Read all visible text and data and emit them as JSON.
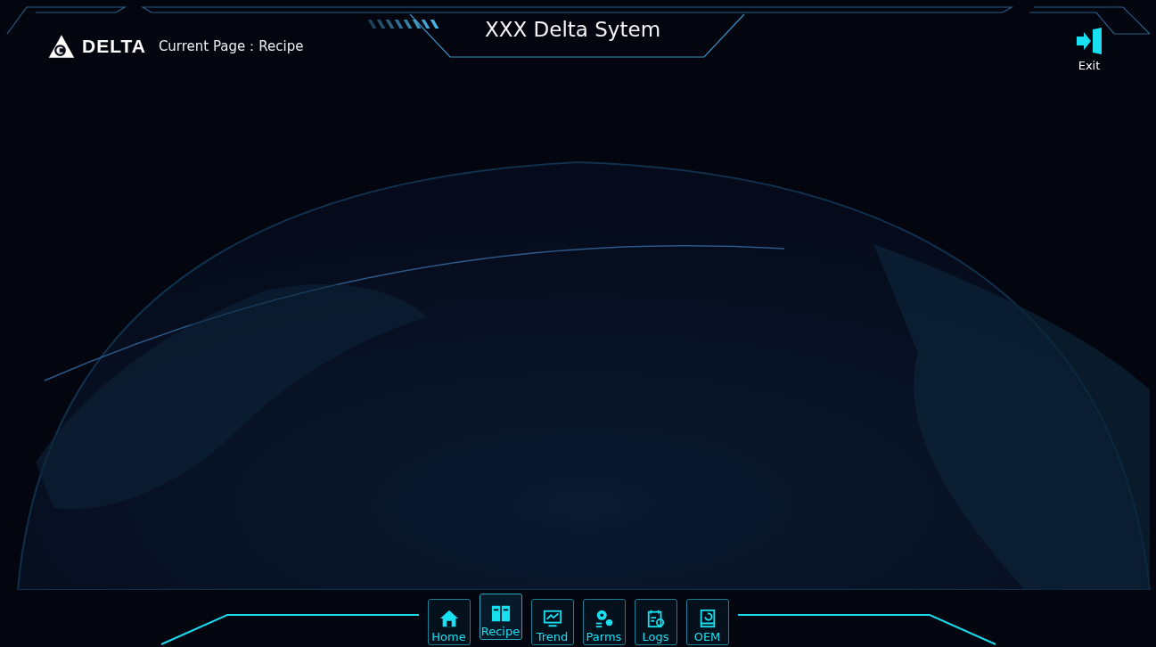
{
  "header": {
    "logo_text": "DELTA",
    "current_page_label": "Current Page：",
    "current_page": "Recipe",
    "title": "XXX Delta Sytem",
    "exit_label": "Exit"
  },
  "nav": [
    {
      "label": "Home",
      "selected": false
    },
    {
      "label": "Recipe",
      "selected": true
    },
    {
      "label": "Trend",
      "selected": false
    },
    {
      "label": "Parms",
      "selected": false
    },
    {
      "label": "Logs",
      "selected": false
    },
    {
      "label": "OEM",
      "selected": false
    }
  ]
}
